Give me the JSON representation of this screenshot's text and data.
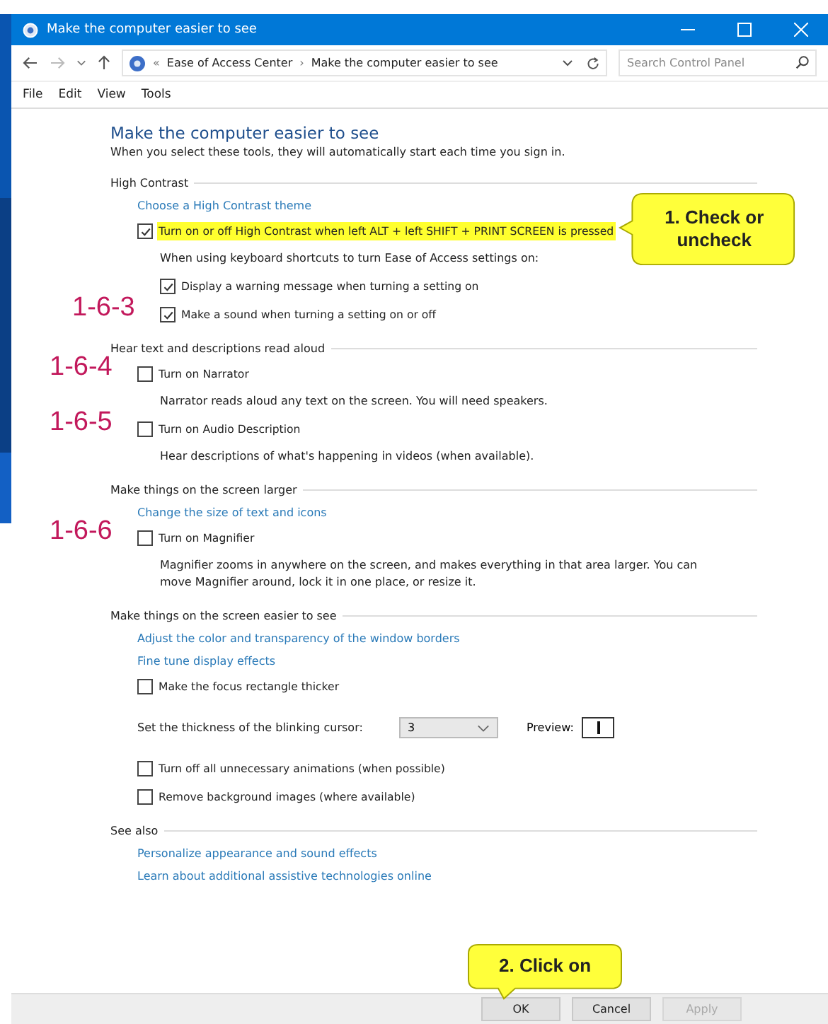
{
  "window": {
    "title": "Make the computer easier to see"
  },
  "address_bar": {
    "path_prefix": "«",
    "path": [
      "Ease of Access Center",
      "Make the computer easier to see"
    ],
    "separator": "›",
    "search_placeholder": "Search Control Panel"
  },
  "menu": [
    "File",
    "Edit",
    "View",
    "Tools"
  ],
  "page": {
    "heading": "Make the computer easier to see",
    "intro": "When you select these tools, they will automatically start each time you sign in."
  },
  "sections": [
    {
      "title": "High Contrast",
      "items": [
        {
          "kind": "link",
          "text": "Choose a High Contrast theme"
        },
        {
          "kind": "checkbox",
          "label": "Turn on or off High Contrast when left ALT + left SHIFT + PRINT SCREEN is pressed",
          "checked": true,
          "highlighted": true,
          "callout": "1. Check or uncheck",
          "children": [
            {
              "kind": "note",
              "text": "When using keyboard shortcuts to turn Ease of Access settings on:"
            },
            {
              "kind": "checkbox",
              "label": "Display a warning message when turning a setting on",
              "checked": true,
              "highlighted": false
            },
            {
              "kind": "checkbox",
              "label": "Make a sound when turning a setting on or off",
              "checked": true,
              "highlighted": false,
              "marker": "1-6-3"
            }
          ]
        }
      ]
    },
    {
      "title": "Hear text and descriptions read aloud",
      "items": [
        {
          "kind": "checkbox",
          "label": "Turn on Narrator",
          "checked": false,
          "highlighted": false,
          "marker": "1-6-4",
          "children": [
            {
              "kind": "note",
              "text": "Narrator reads aloud any text on the screen. You will need speakers."
            }
          ]
        },
        {
          "kind": "checkbox",
          "label": "Turn on Audio Description",
          "checked": false,
          "highlighted": false,
          "marker": "1-6-5",
          "children": [
            {
              "kind": "note",
              "text": "Hear descriptions of what's happening in videos (when available)."
            }
          ]
        }
      ]
    },
    {
      "title": "Make things on the screen larger",
      "items": [
        {
          "kind": "link",
          "text": "Change the size of text and icons"
        },
        {
          "kind": "checkbox",
          "label": "Turn on Magnifier",
          "checked": false,
          "highlighted": false,
          "marker": "1-6-6",
          "children": [
            {
              "kind": "note",
              "text": "Magnifier zooms in anywhere on the screen, and makes everything in that area larger. You can move Magnifier around, lock it in one place, or resize it."
            }
          ]
        }
      ]
    },
    {
      "title": "Make things on the screen easier to see",
      "items": [
        {
          "kind": "link",
          "text": "Adjust the color and transparency of the window borders"
        },
        {
          "kind": "link",
          "text": "Fine tune display effects"
        },
        {
          "kind": "checkbox",
          "label": "Make the focus rectangle thicker",
          "checked": false,
          "highlighted": false
        },
        {
          "kind": "select",
          "label": "Set the thickness of the blinking cursor:",
          "value": "3",
          "preview_label": "Preview:"
        },
        {
          "kind": "checkbox",
          "label": "Turn off all unnecessary animations (when possible)",
          "checked": false,
          "highlighted": false
        },
        {
          "kind": "checkbox",
          "label": "Remove background images (where available)",
          "checked": false,
          "highlighted": false
        }
      ]
    },
    {
      "title": "See also",
      "items": [
        {
          "kind": "link",
          "text": "Personalize appearance and sound effects"
        },
        {
          "kind": "link",
          "text": "Learn about additional assistive technologies online"
        }
      ]
    }
  ],
  "buttons": [
    {
      "label": "OK",
      "disabled": false,
      "callout": "2. Click on"
    },
    {
      "label": "Cancel",
      "disabled": false
    },
    {
      "label": "Apply",
      "disabled": true
    }
  ]
}
